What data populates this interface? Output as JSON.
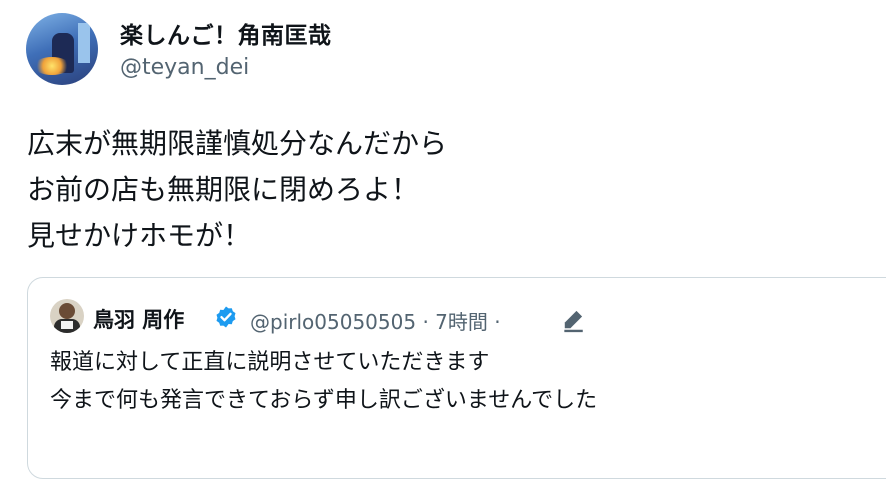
{
  "author": {
    "display_name": "楽しんご！角南匡哉",
    "handle": "@teyan_dei",
    "avatar_icon": "profile-avatar"
  },
  "tweet": {
    "lines": [
      "広末が無期限謹慎処分なんだから",
      "お前の店も無期限に閉めろよ！",
      "見せかけホモが！"
    ]
  },
  "quoted": {
    "display_name": "鳥羽 周作",
    "verified_icon": "verified-badge-icon",
    "handle": "@pirlo05050505",
    "separator1": "·",
    "time": "7時間",
    "separator2": "·",
    "edit_icon": "edited-pencil-icon",
    "lines": [
      "報道に対して正直に説明させていただきます",
      "今まで何も発言できておらず申し訳ございませんでした"
    ]
  },
  "colors": {
    "text": "#0f1419",
    "secondary": "#536471",
    "border": "#cfd9de",
    "verified": "#1d9bf0"
  }
}
